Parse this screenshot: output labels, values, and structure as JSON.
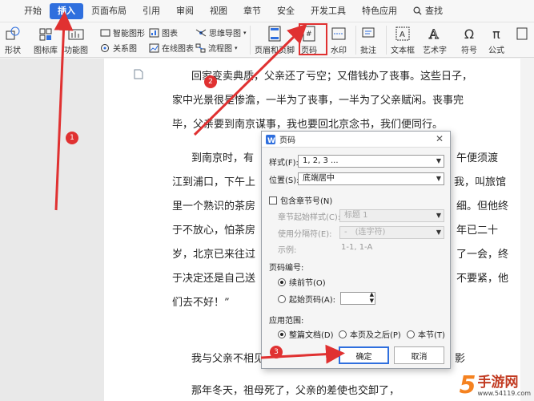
{
  "menubar": {
    "items": [
      "开始",
      "插入",
      "页面布局",
      "引用",
      "审阅",
      "视图",
      "章节",
      "安全",
      "开发工具",
      "特色应用"
    ],
    "active": "插入",
    "search_label": "查找"
  },
  "ribbon": {
    "shapes": "形状",
    "icon_lib": "图标库",
    "func_chart": "功能图",
    "smart_shape": "智能图形",
    "chart": "图表",
    "mind_map": "思维导图",
    "relation_map": "关系图",
    "online_chart": "在线图表",
    "flowchart": "流程图",
    "header_footer": "页眉和页脚",
    "page_number": "页码",
    "watermark": "水印",
    "comment": "批注",
    "textbox": "文本框",
    "art_text": "艺术字",
    "symbol": "符号",
    "formula": "公式"
  },
  "document": {
    "lines": [
      "回家变卖典质，父亲还了亏空；又借钱办了丧事。这些日子，",
      "家中光景很是惨澹，一半为了丧事，一半为了父亲赋闲。丧事完",
      "毕，父亲要到南京谋事，我也要回北京念书，我们便同行。",
      "到南京时，有",
      "江到浦口，下午上",
      "里一个熟识的茶房",
      "于不放心，怕茶房",
      "岁，北京已来往过",
      "于决定还是自己送",
      "们去不好！”",
      "我与父亲不相见",
      "那年冬天，祖母死了，父亲的差使也交卸了，"
    ],
    "right_fragments": [
      "午便须渡",
      "我，叫旅馆",
      "细。但他终",
      "年已二十",
      "了一会，终",
      "不要紧，他",
      "影"
    ]
  },
  "dialog": {
    "title": "页码",
    "style_label": "样式(F):",
    "style_value": "1, 2, 3 ...",
    "position_label": "位置(S):",
    "position_value": "底端居中",
    "include_chapter": "包含章节号(N)",
    "chapter_style_label": "章节起始样式(C):",
    "chapter_style_value": "标题 1",
    "separator_label": "使用分隔符(E):",
    "separator_value": "-　(连字符)",
    "example_label": "示例:",
    "example_value": "1-1, 1-A",
    "numbering_label": "页码编号:",
    "continue_label": "续前节(O)",
    "start_label": "起始页码(A):",
    "apply_label": "应用范围:",
    "apply_whole": "整篇文档(D)",
    "apply_after": "本页及之后(P)",
    "apply_section": "本节(T)",
    "ok": "确定",
    "cancel": "取消"
  },
  "annotations": {
    "badge1": "1",
    "badge2": "2",
    "badge3": "3",
    "color": "#e03131"
  },
  "watermark": {
    "logo_num": "5",
    "text": "手游网",
    "url": "www.54119.com"
  }
}
